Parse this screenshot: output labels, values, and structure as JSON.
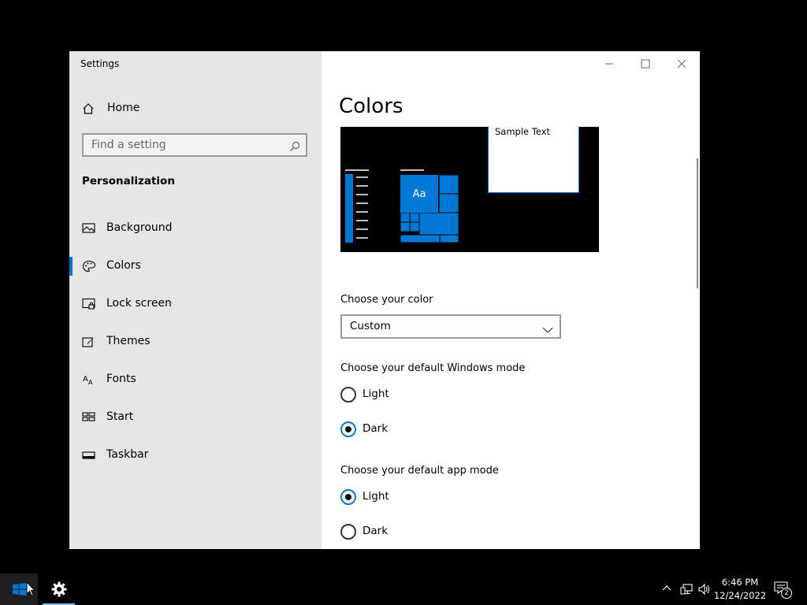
{
  "window": {
    "app_title": "Settings",
    "home_label": "Home",
    "search_placeholder": "Find a setting",
    "section_title": "Personalization",
    "nav": [
      {
        "label": "Background",
        "icon": "picture-icon"
      },
      {
        "label": "Colors",
        "icon": "palette-icon",
        "selected": true
      },
      {
        "label": "Lock screen",
        "icon": "lock-screen-icon"
      },
      {
        "label": "Themes",
        "icon": "brush-icon"
      },
      {
        "label": "Fonts",
        "icon": "font-icon"
      },
      {
        "label": "Start",
        "icon": "start-icon"
      },
      {
        "label": "Taskbar",
        "icon": "taskbar-icon"
      }
    ]
  },
  "content": {
    "page_title": "Colors",
    "preview": {
      "sample_text": "Sample Text",
      "tile_text": "Aa"
    },
    "choose_color_label": "Choose your color",
    "choose_color_value": "Custom",
    "windows_mode_label": "Choose your default Windows mode",
    "windows_mode_options": [
      {
        "label": "Light",
        "checked": false
      },
      {
        "label": "Dark",
        "checked": true
      }
    ],
    "app_mode_label": "Choose your default app mode",
    "app_mode_options": [
      {
        "label": "Light",
        "checked": true
      },
      {
        "label": "Dark",
        "checked": false
      }
    ]
  },
  "taskbar": {
    "time": "6:46 PM",
    "date": "12/24/2022",
    "notification_count": "2"
  },
  "colors": {
    "accent": "#0078d4",
    "sidebar_bg": "#e6e6e6"
  }
}
